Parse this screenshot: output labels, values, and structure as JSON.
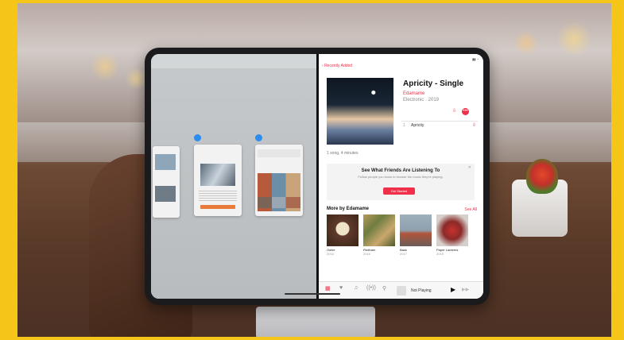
{
  "music": {
    "back_label": "Recently Added",
    "album_title": "Apricity - Single",
    "artist": "Edamame",
    "genre_year": "Electronic · 2019",
    "track_number": "1",
    "track_name": "Apricity",
    "song_count": "1 song, 4 minutes",
    "friends_title": "See What Friends Are Listening To",
    "friends_desc": "Follow people you know to browse the music they're playing.",
    "get_started": "Get Started",
    "more_by": "More by Edamame",
    "see_all": "See All",
    "releases": [
      {
        "title": "Oshie",
        "year": "2016"
      },
      {
        "title": "Redbarn",
        "year": "2015"
      },
      {
        "title": "Bask",
        "year": "2017"
      },
      {
        "title": "Paper Lanterns",
        "year": "2015"
      }
    ],
    "now_playing": "Not Playing"
  },
  "colors": {
    "accent": "#f0304a",
    "frame": "#f5c518"
  },
  "icons": [
    "chevron-left-icon",
    "download-icon",
    "more-icon",
    "close-icon",
    "play-icon",
    "forward-icon"
  ]
}
